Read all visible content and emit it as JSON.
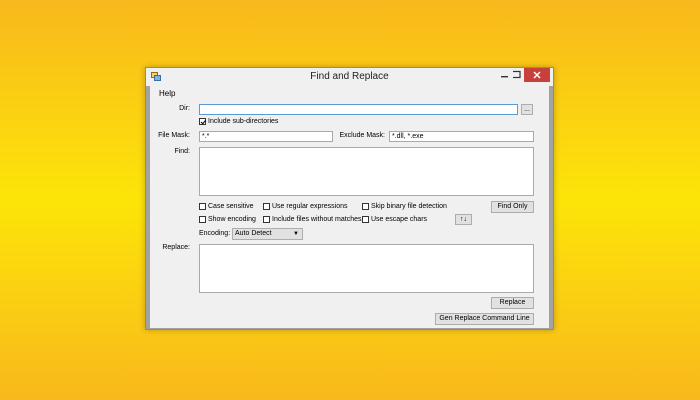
{
  "window": {
    "title": "Find and Replace",
    "colors": {
      "close": "#c7403a",
      "background": "#f0f0f0",
      "desktop": "#fde508"
    }
  },
  "menu": {
    "help": "Help"
  },
  "dir": {
    "label": "Dir:",
    "value": "",
    "browse_label": "...",
    "include_subdirs": {
      "label": "Include sub-directories",
      "checked": true
    }
  },
  "file_mask": {
    "label": "File Mask:",
    "value": "*.*"
  },
  "exclude_mask": {
    "label": "Exclude Mask:",
    "value": "*.dll, *.exe"
  },
  "find": {
    "label": "Find:",
    "value": ""
  },
  "options": {
    "case_sensitive": {
      "label": "Case sensitive",
      "checked": false
    },
    "show_encoding": {
      "label": "Show encoding",
      "checked": false
    },
    "regex": {
      "label": "Use regular expressions",
      "checked": false
    },
    "include_no_match": {
      "label": "Include files without matches",
      "checked": false
    },
    "skip_binary": {
      "label": "Skip binary file detection",
      "checked": false
    },
    "escape_chars": {
      "label": "Use escape chars",
      "checked": false
    }
  },
  "find_only_label": "Find Only",
  "swap_label": "↑↓",
  "encoding": {
    "label": "Encoding:",
    "value": "Auto Detect"
  },
  "replace": {
    "label": "Replace:",
    "value": ""
  },
  "replace_label": "Replace",
  "gen_cmd_label": "Gen Replace Command Line",
  "icons": [
    "app-icon",
    "minimize-icon",
    "maximize-icon",
    "close-icon",
    "chevron-down-icon"
  ]
}
